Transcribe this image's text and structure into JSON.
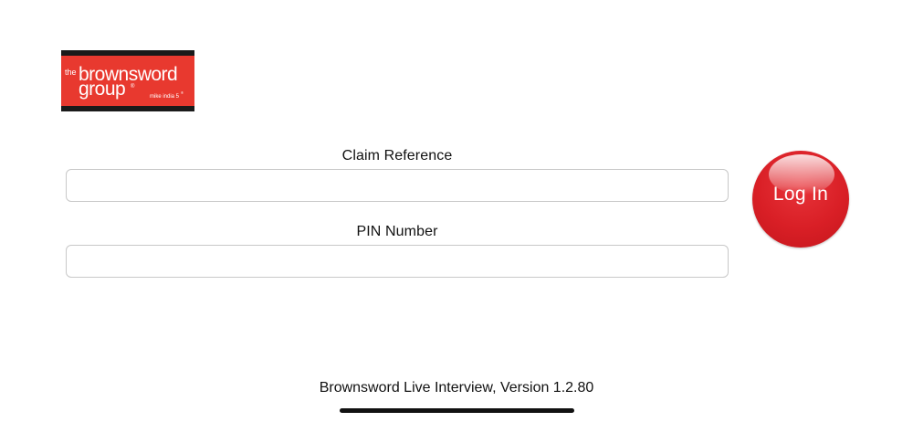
{
  "logo": {
    "line1_small": "the",
    "line1_main": "brownsword",
    "line2_main": "group",
    "registered_mark": "®",
    "tagline": "mike india 5",
    "tagline_mark": "®",
    "colors": {
      "background": "#e8392f",
      "frame": "#1a1a1a",
      "text": "#ffffff"
    }
  },
  "form": {
    "claim_label": "Claim Reference",
    "claim_value": "",
    "pin_label": "PIN Number",
    "pin_value": ""
  },
  "login": {
    "label": "Log In",
    "color": "#d91f26"
  },
  "footer": {
    "version_text": "Brownsword Live Interview, Version 1.2.80"
  }
}
